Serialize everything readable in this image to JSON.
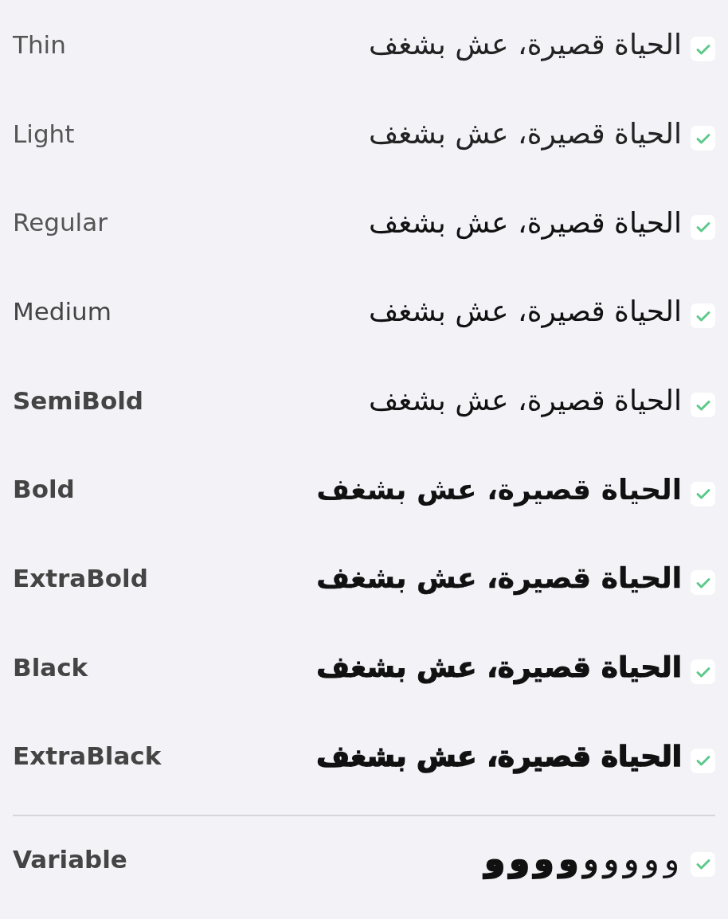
{
  "weights": [
    {
      "label": "Thin",
      "sample": "الحياة قصيرة، عش بشغف",
      "checked": true
    },
    {
      "label": "Light",
      "sample": "الحياة قصيرة، عش بشغف",
      "checked": true
    },
    {
      "label": "Regular",
      "sample": "الحياة قصيرة، عش بشغف",
      "checked": true
    },
    {
      "label": "Medium",
      "sample": "الحياة قصيرة، عش بشغف",
      "checked": true
    },
    {
      "label": "SemiBold",
      "sample": "الحياة قصيرة، عش بشغف",
      "checked": true
    },
    {
      "label": "Bold",
      "sample": "الحياة قصيرة، عش بشغف",
      "checked": true
    },
    {
      "label": "ExtraBold",
      "sample": "الحياة قصيرة، عش بشغف",
      "checked": true
    },
    {
      "label": "Black",
      "sample": "الحياة قصيرة، عش بشغف",
      "checked": true
    },
    {
      "label": "ExtraBlack",
      "sample": "الحياة قصيرة، عش بشغف",
      "checked": true
    }
  ],
  "variable": {
    "label": "Variable",
    "glyphs": [
      "و",
      "و",
      "و",
      "و",
      "و",
      "و",
      "و",
      "و",
      "و"
    ],
    "checked": true
  }
}
